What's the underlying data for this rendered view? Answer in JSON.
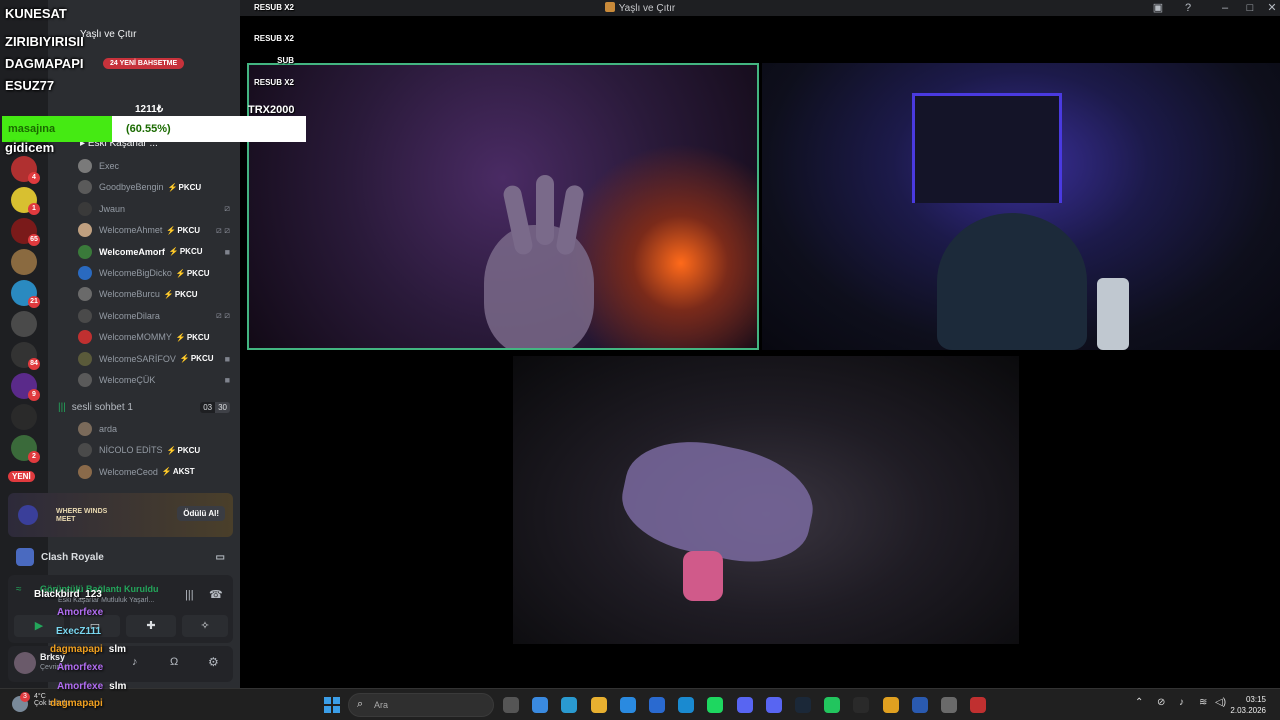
{
  "window": {
    "title": "Yaşlı ve Çıtır",
    "controls": [
      "inbox-icon",
      "help-icon",
      "minimize-icon",
      "maximize-icon",
      "close-icon"
    ]
  },
  "server_rail": {
    "servers": [
      {
        "badge": "4",
        "color": "#b03030"
      },
      {
        "badge": "1",
        "color": "#d8c030"
      },
      {
        "badge": "65",
        "color": "#7a1a1a"
      },
      {
        "badge": "",
        "color": "#8a6a40"
      },
      {
        "badge": "21",
        "color": "#2a8ac0"
      },
      {
        "badge": "",
        "color": "#4a4a4a"
      },
      {
        "badge": "84",
        "color": "#333333"
      },
      {
        "badge": "9",
        "color": "#5a2a8a"
      },
      {
        "badge": "",
        "color": "#2a2a2a"
      },
      {
        "badge": "2",
        "color": "#3a6a3a"
      }
    ],
    "new_label": "YENİ"
  },
  "channel_list": {
    "server_name": "Yaşlı ve Çıtır",
    "voice_channel_1": "Eski Kaşarlar ...",
    "members_1": [
      {
        "name": "Exec",
        "tag": "",
        "right": "",
        "color": "#7a7a7a"
      },
      {
        "name": "GoodbyeBengin",
        "tag": "PKCU",
        "right": "",
        "color": "#5a5a5a"
      },
      {
        "name": "Jwaun",
        "tag": "",
        "right": "⧄",
        "color": "#3a3a3a"
      },
      {
        "name": "WelcomeAhmet",
        "tag": "PKCU",
        "right": "⧄ ⧄",
        "color": "#c0a080"
      },
      {
        "name": "WelcomeAmorf",
        "tag": "PKCU",
        "right": "■",
        "color": "#3a7a3a",
        "active": true
      },
      {
        "name": "WelcomeBigDicko",
        "tag": "PKCU",
        "right": "",
        "color": "#2a6ac0"
      },
      {
        "name": "WelcomeBurcu",
        "tag": "PKCU",
        "right": "",
        "color": "#6a6a6a"
      },
      {
        "name": "WelcomeDilara",
        "tag": "",
        "right": "⧄ ⧄",
        "color": "#4a4a4a"
      },
      {
        "name": "WelcomeMOMMY",
        "tag": "PKCU",
        "right": "",
        "color": "#c03030"
      },
      {
        "name": "WelcomeSARİFOV",
        "tag": "PKCU",
        "right": "■",
        "color": "#5a5a3a"
      },
      {
        "name": "WelcomeÇÜK",
        "tag": "",
        "right": "■",
        "color": "#5a5a5a"
      }
    ],
    "voice_channel_2": {
      "name": "sesli sohbet 1",
      "count_a": "03",
      "count_b": "30"
    },
    "members_2": [
      {
        "name": "arda",
        "tag": "",
        "right": "",
        "color": "#7a6a5a"
      },
      {
        "name": "NİCOLO EDİTS",
        "tag": "PKCU",
        "right": "",
        "color": "#4a4a4a"
      },
      {
        "name": "WelcomeCeod",
        "tag": "AKST",
        "right": "",
        "color": "#8a6a4a"
      }
    ]
  },
  "promo": {
    "title": "WHERE WINDS MEET",
    "button": "Ödülü Al!"
  },
  "activity": {
    "name": "Clash Royale"
  },
  "voice_panel": {
    "status": "Görüntülü Bağlantı Kuruldu",
    "channel": "Eski Kaşarlar Mutluluk Yaşarl..."
  },
  "user_panel": {
    "name": "Brksy",
    "sub": "Çevrimiçi"
  },
  "overlay": {
    "names": [
      "KUNESAT",
      "ZIRIBIYIRISII",
      "DAGMAPAPI",
      "ESUZ77",
      "gidicem"
    ],
    "events": [
      "RESUB X2",
      "RESUB X2",
      "SUB",
      "RESUB X2"
    ],
    "bet_pill": "24 YENİ BAHSETME",
    "viewers": "1211₺",
    "trx": "TRX2000",
    "goal": {
      "label": "masajına",
      "percent_text": "(60.55%)",
      "fraction": 0.6055
    },
    "chat": [
      {
        "user": "Blackbird_123",
        "text": "",
        "color": "#ffffff"
      },
      {
        "user": "Amorfexe",
        "text": "",
        "color": "#b06cf0"
      },
      {
        "user": "ExecZ111",
        "text": "",
        "color": "#7ad7f0"
      },
      {
        "user": "dagmapapi",
        "text": "slm",
        "color": "#f0a020"
      },
      {
        "user": "Amorfexe",
        "text": "",
        "color": "#b06cf0"
      },
      {
        "user": "Amorfexe",
        "text": "slm",
        "color": "#b06cf0"
      },
      {
        "user": "dagmapapi",
        "text": "",
        "color": "#f0a020"
      }
    ]
  },
  "taskbar": {
    "weather": {
      "temp": "4°C",
      "desc": "Çok bulutlu",
      "badge": "3"
    },
    "search_placeholder": "Ara",
    "time": "03:15",
    "date": "2.03.2026"
  }
}
